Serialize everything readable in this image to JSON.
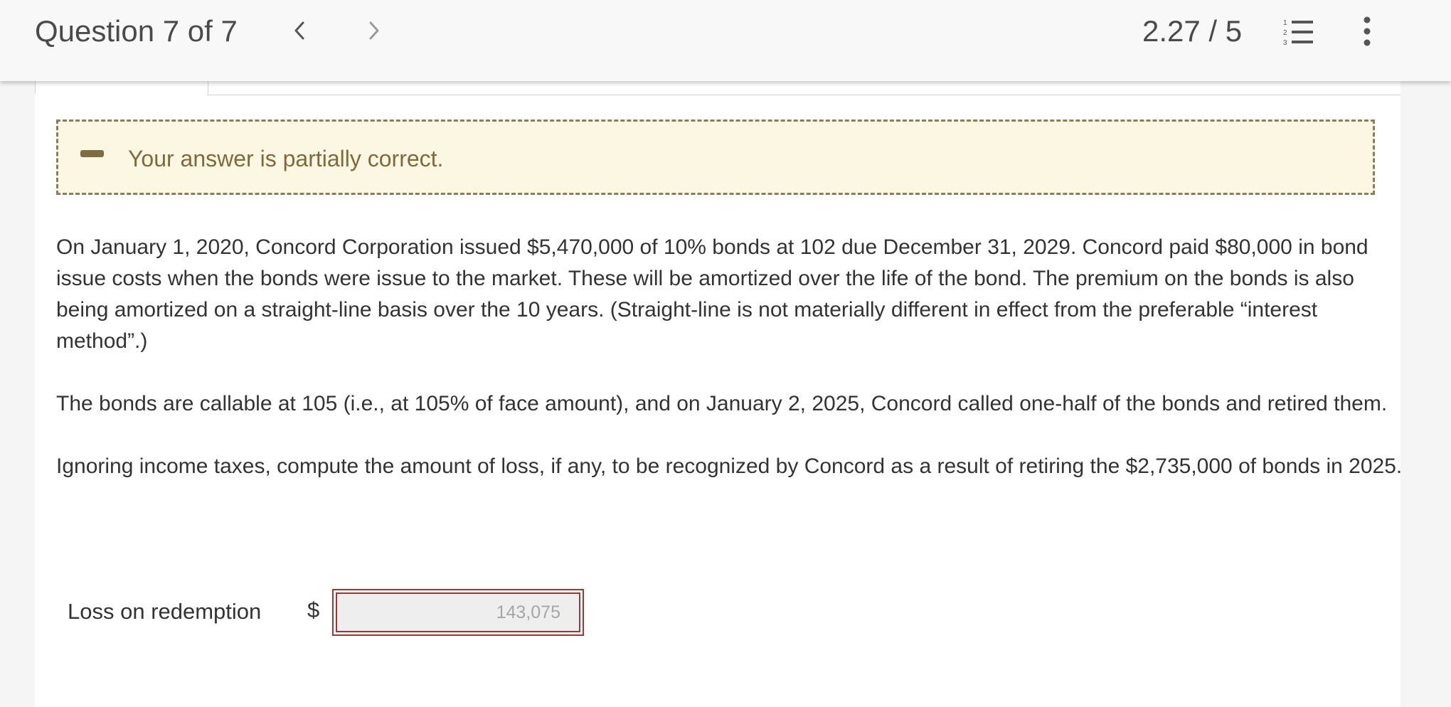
{
  "header": {
    "question_title": "Question 7 of 7",
    "prev_icon": "chevron-left-icon",
    "next_icon": "chevron-right-icon",
    "score": "2.27 / 5",
    "list_icon": "numbered-list-icon",
    "more_icon": "vertical-ellipsis-icon"
  },
  "feedback": {
    "icon": "minus-icon",
    "message": "Your answer is partially correct.",
    "border_color": "#8b7d5a",
    "background_color": "#fcf7e3"
  },
  "question": {
    "paragraph_1": "On January 1, 2020, Concord Corporation issued $5,470,000 of 10% bonds at 102 due December 31, 2029. Concord paid $80,000 in bond issue costs when the bonds were issue to the market. These will be amortized over the life of the bond. The premium on the bonds is also being amortized on a straight-line basis over the 10 years. (Straight-line is not materially different in effect from the preferable “interest method”.)",
    "paragraph_2": "The bonds are callable at 105 (i.e., at 105% of face amount), and on January 2, 2025, Concord called one-half of the bonds and retired them.",
    "paragraph_3": "Ignoring income taxes, compute the amount of loss, if any, to be recognized by Concord as a result of retiring the $2,735,000 of bonds in 2025."
  },
  "answer": {
    "label": "Loss on redemption",
    "currency": "$",
    "value": "143,075",
    "status_color": "#a23434"
  }
}
